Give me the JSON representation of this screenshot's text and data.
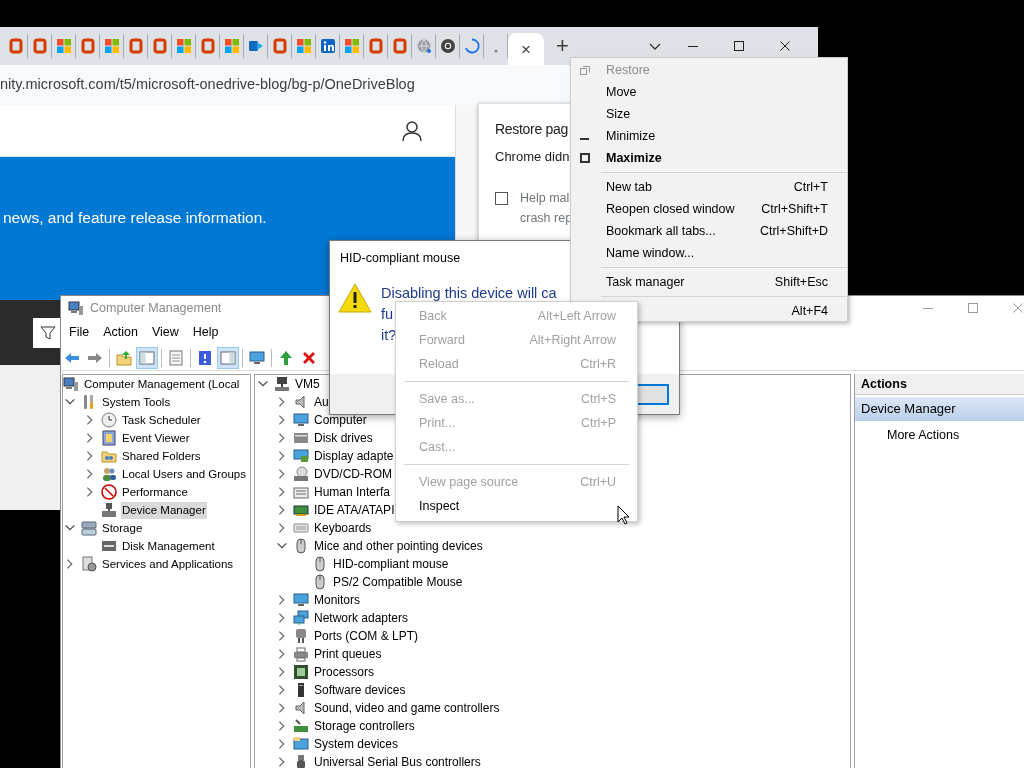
{
  "browser": {
    "tabs": [
      {
        "kind": "office",
        "selected": false
      },
      {
        "kind": "office",
        "selected": false
      },
      {
        "kind": "windows",
        "selected": false
      },
      {
        "kind": "office",
        "selected": false
      },
      {
        "kind": "windows",
        "selected": false
      },
      {
        "kind": "office",
        "selected": false
      },
      {
        "kind": "office",
        "selected": false
      },
      {
        "kind": "windows",
        "selected": false
      },
      {
        "kind": "office",
        "selected": false
      },
      {
        "kind": "windows",
        "selected": false
      },
      {
        "kind": "outlook",
        "selected": false
      },
      {
        "kind": "office",
        "selected": false
      },
      {
        "kind": "windows",
        "selected": false
      },
      {
        "kind": "linkedin",
        "selected": false
      },
      {
        "kind": "windows",
        "selected": false
      },
      {
        "kind": "office",
        "selected": false
      },
      {
        "kind": "office",
        "selected": false
      },
      {
        "kind": "globe",
        "selected": false
      },
      {
        "kind": "chrome",
        "selected": false
      },
      {
        "kind": "loading",
        "selected": false
      },
      {
        "kind": "dot",
        "selected": false
      },
      {
        "kind": "blank",
        "selected": true,
        "close": "×"
      }
    ],
    "new_tab": "+",
    "address": "nity.microsoft.com/t5/microsoft-onedrive-blog/bg-p/OneDriveBlog",
    "banner_text": "news, and feature release information.",
    "restore_bubble": {
      "title": "Restore pag",
      "message": "Chrome didn",
      "checkbox": {
        "checked": false,
        "label_lines": [
          "Help mal",
          "crash rep"
        ]
      }
    }
  },
  "computer_management": {
    "title": "Computer Management",
    "menu": [
      "File",
      "Action",
      "View",
      "Help"
    ],
    "tree": [
      {
        "label": "Computer Management (Local",
        "selected": false,
        "children": [
          {
            "label": "System Tools",
            "expanded": true,
            "selected": false,
            "children": [
              {
                "label": "Task Scheduler",
                "expanded": false,
                "selected": false
              },
              {
                "label": "Event Viewer",
                "expanded": false,
                "selected": false
              },
              {
                "label": "Shared Folders",
                "expanded": false,
                "selected": false
              },
              {
                "label": "Local Users and Groups",
                "expanded": false,
                "selected": false
              },
              {
                "label": "Performance",
                "expanded": false,
                "selected": false
              },
              {
                "label": "Device Manager",
                "selected": true
              }
            ]
          },
          {
            "label": "Storage",
            "expanded": true,
            "selected": false,
            "children": [
              {
                "label": "Disk Management",
                "selected": false
              }
            ]
          },
          {
            "label": "Services and Applications",
            "expanded": false,
            "selected": false
          }
        ]
      }
    ],
    "devices": [
      {
        "label": "VM5",
        "expanded": true,
        "selected": false,
        "children": [
          {
            "label": "Au",
            "expanded": false,
            "selected": false
          },
          {
            "label": "Computer",
            "expanded": false,
            "selected": false
          },
          {
            "label": "Disk drives",
            "expanded": false,
            "selected": false
          },
          {
            "label": "Display adapte",
            "expanded": false,
            "selected": false
          },
          {
            "label": "DVD/CD-ROM",
            "expanded": false,
            "selected": false
          },
          {
            "label": "Human Interfa",
            "expanded": false,
            "selected": false
          },
          {
            "label": "IDE ATA/ATAPI",
            "expanded": false,
            "selected": false
          },
          {
            "label": "Keyboards",
            "expanded": false,
            "selected": false
          },
          {
            "label": "Mice and other pointing devices",
            "expanded": true,
            "selected": false,
            "children": [
              {
                "label": "HID-compliant mouse",
                "selected": false
              },
              {
                "label": "PS/2 Compatible Mouse",
                "selected": false
              }
            ]
          },
          {
            "label": "Monitors",
            "expanded": false,
            "selected": false
          },
          {
            "label": "Network adapters",
            "expanded": false,
            "selected": false
          },
          {
            "label": "Ports (COM & LPT)",
            "expanded": false,
            "selected": false
          },
          {
            "label": "Print queues",
            "expanded": false,
            "selected": false
          },
          {
            "label": "Processors",
            "expanded": false,
            "selected": false
          },
          {
            "label": "Software devices",
            "expanded": false,
            "selected": false
          },
          {
            "label": "Sound, video and game controllers",
            "expanded": false,
            "selected": false
          },
          {
            "label": "Storage controllers",
            "expanded": false,
            "selected": false
          },
          {
            "label": "System devices",
            "expanded": false,
            "selected": false
          },
          {
            "label": "Universal Serial Bus controllers",
            "expanded": false,
            "selected": false
          }
        ]
      }
    ],
    "actions": {
      "header": "Actions",
      "section": "Device Manager",
      "items": [
        "More Actions"
      ]
    }
  },
  "dialog": {
    "title": "HID-compliant mouse",
    "message_lines": [
      "Disabling this device will ca",
      "fu",
      "it?"
    ]
  },
  "system_menu": {
    "groups": [
      [
        {
          "kind": "restore",
          "label": "Restore",
          "disabled": true,
          "default": false
        },
        {
          "kind": "plain",
          "label": "Move",
          "disabled": false,
          "default": false
        },
        {
          "kind": "plain",
          "label": "Size",
          "disabled": false,
          "default": false
        },
        {
          "kind": "minimize",
          "label": "Minimize",
          "disabled": false,
          "default": false
        },
        {
          "kind": "maximize",
          "label": "Maximize",
          "disabled": false,
          "default": true
        }
      ],
      [
        {
          "kind": "plain",
          "label": "New tab",
          "shortcut": "Ctrl+T",
          "disabled": false,
          "default": false
        },
        {
          "kind": "plain",
          "label": "Reopen closed window",
          "shortcut": "Ctrl+Shift+T",
          "disabled": false,
          "default": false
        },
        {
          "kind": "plain",
          "label": "Bookmark all tabs...",
          "shortcut": "Ctrl+Shift+D",
          "disabled": false,
          "default": false
        },
        {
          "kind": "plain",
          "label": "Name window...",
          "disabled": false,
          "default": false
        }
      ],
      [
        {
          "kind": "plain",
          "label": "Task manager",
          "shortcut": "Shift+Esc",
          "disabled": false,
          "default": false
        }
      ],
      [
        {
          "kind": "plain",
          "shortcut": "Alt+F4",
          "disabled": false,
          "default": false
        }
      ]
    ]
  },
  "context_menu": {
    "groups": [
      [
        {
          "label": "Back",
          "shortcut": "Alt+Left Arrow",
          "disabled": true
        },
        {
          "label": "Forward",
          "shortcut": "Alt+Right Arrow",
          "disabled": true
        },
        {
          "label": "Reload",
          "shortcut": "Ctrl+R",
          "disabled": true
        }
      ],
      [
        {
          "label": "Save as...",
          "shortcut": "Ctrl+S",
          "disabled": true
        },
        {
          "label": "Print...",
          "shortcut": "Ctrl+P",
          "disabled": true
        },
        {
          "label": "Cast...",
          "disabled": true
        }
      ],
      [
        {
          "label": "View page source",
          "shortcut": "Ctrl+U",
          "disabled": true
        },
        {
          "label": "Inspect",
          "disabled": false
        }
      ]
    ]
  }
}
